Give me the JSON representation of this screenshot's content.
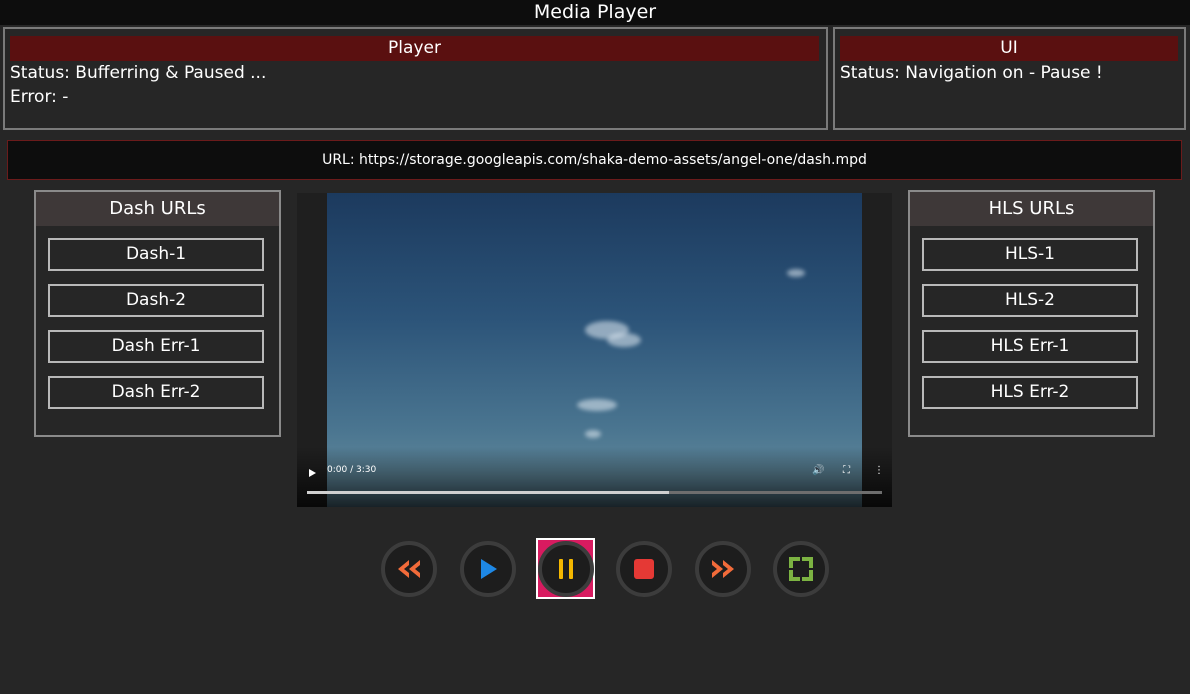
{
  "app": {
    "title": "Media Player"
  },
  "player_panel": {
    "title": "Player",
    "status": "Status: Bufferring & Paused ...",
    "error": "Error: -"
  },
  "ui_panel": {
    "title": "UI",
    "status": "Status: Navigation on - Pause !"
  },
  "url_bar": {
    "text": "URL: https://storage.googleapis.com/shaka-demo-assets/angel-one/dash.mpd"
  },
  "dash_list": {
    "title": "Dash URLs",
    "items": [
      "Dash-1",
      "Dash-2",
      "Dash Err-1",
      "Dash Err-2"
    ]
  },
  "hls_list": {
    "title": "HLS URLs",
    "items": [
      "HLS-1",
      "HLS-2",
      "HLS Err-1",
      "HLS Err-2"
    ]
  },
  "video": {
    "time": "0:00 / 3:30",
    "buffered_fraction": 0.63
  },
  "controls": {
    "focused": "pause",
    "colors": {
      "rewind": "#f26b3a",
      "play": "#1e88e5",
      "pause": "#f5b800",
      "stop": "#e53935",
      "forward": "#f26b3a",
      "fullscreen": "#7cb342",
      "focus": "#d81b60"
    },
    "icons": [
      "rewind-icon",
      "play-icon",
      "pause-icon",
      "stop-icon",
      "fast-forward-icon",
      "fullscreen-icon"
    ]
  }
}
